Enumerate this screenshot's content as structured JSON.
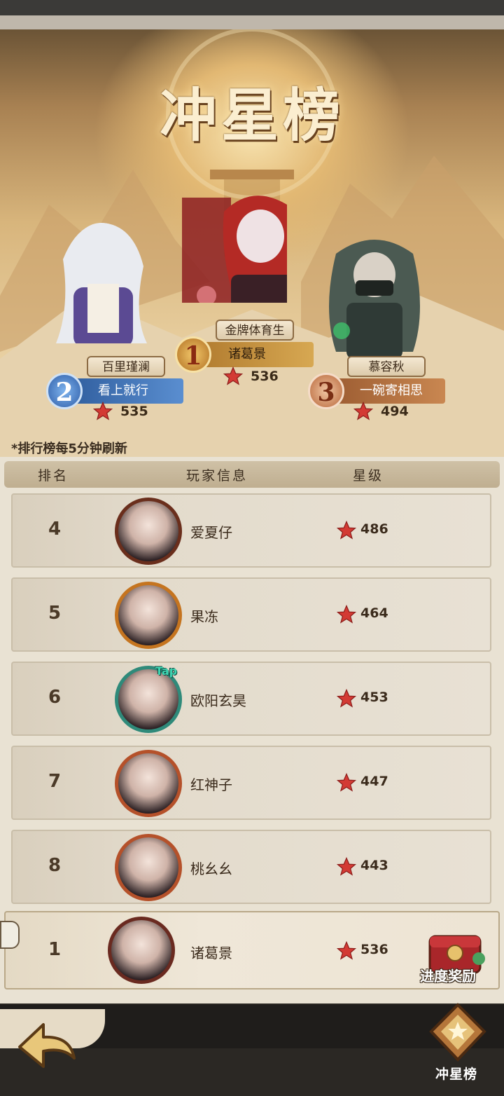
{
  "title": "冲星榜",
  "podium": [
    {
      "rank": "1",
      "title_badge": "金牌体育生",
      "name": "诸葛景",
      "score": "536"
    },
    {
      "rank": "2",
      "title_badge": "百里瑾澜",
      "name": "看上就行",
      "score": "535"
    },
    {
      "rank": "3",
      "title_badge": "慕容秋",
      "name": "一碗寄相思",
      "score": "494"
    }
  ],
  "refresh_note": "*排行榜每5分钟刷新",
  "table": {
    "headers": {
      "rank": "排名",
      "player": "玩家信息",
      "stars": "星级"
    },
    "rows": [
      {
        "rank": "4",
        "name": "爱夏仔",
        "score": "486"
      },
      {
        "rank": "5",
        "name": "果冻",
        "score": "464"
      },
      {
        "rank": "6",
        "name": "欧阳玄昊",
        "score": "453"
      },
      {
        "rank": "7",
        "name": "红神子",
        "score": "447"
      },
      {
        "rank": "8",
        "name": "桃幺幺",
        "score": "443"
      }
    ],
    "my_row": {
      "rank": "1",
      "name": "诸葛景",
      "score": "536"
    }
  },
  "avatar_badge": "Tap",
  "progress_reward_label": "进度奖励",
  "nav": {
    "current_label": "冲星榜"
  },
  "colors": {
    "star": "#d33a34",
    "gold": "#c7903d",
    "blue": "#3f74b8",
    "bronze": "#b8673a"
  }
}
